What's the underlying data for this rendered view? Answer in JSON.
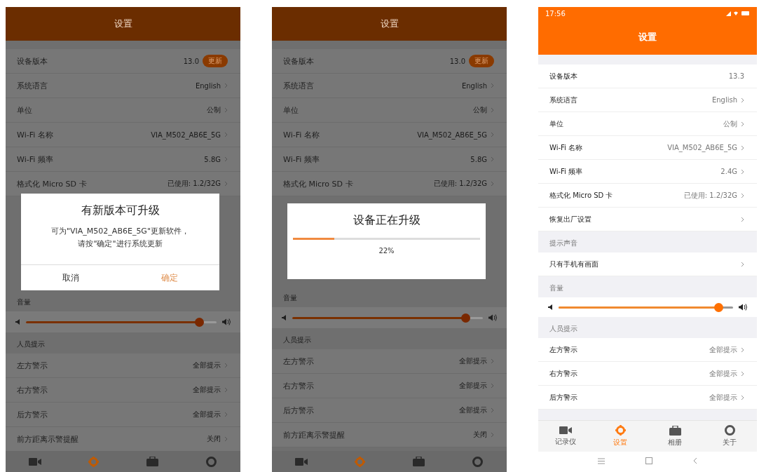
{
  "phones": [
    {
      "dimmed": true,
      "title": "设置",
      "blocks": [
        {
          "kind": "row",
          "label": "设备版本",
          "value": "13.0",
          "badge": "更新",
          "arrow": false
        },
        {
          "kind": "row",
          "label": "系统语言",
          "value": "English",
          "arrow": true
        },
        {
          "kind": "row",
          "label": "单位",
          "value": "公制",
          "arrow": true
        },
        {
          "kind": "row",
          "label": "Wi-Fi 名称",
          "value": "VIA_M502_AB6E_5G",
          "arrow": true
        },
        {
          "kind": "row",
          "label": "Wi-Fi 频率",
          "value": "5.8G",
          "arrow": true
        },
        {
          "kind": "row",
          "label": "格式化 Micro SD 卡",
          "value": "已使用: 1.2/32G",
          "arrow": true
        },
        {
          "kind": "confirm",
          "title": "有新版本可升级",
          "message_lines": [
            "可为\"VIA_M502_AB6E_5G\"更新软件，",
            "请按\"确定\"进行系统更新"
          ],
          "buttons": [
            {
              "label": "取消",
              "primary": false
            },
            {
              "label": "确定",
              "primary": true
            }
          ]
        },
        {
          "kind": "section",
          "label": "音量"
        },
        {
          "kind": "slider",
          "level": 0.93
        },
        {
          "kind": "section",
          "label": "人员提示"
        },
        {
          "kind": "row",
          "label": "左方警示",
          "value": "全部提示",
          "arrow": true
        },
        {
          "kind": "row",
          "label": "右方警示",
          "value": "全部提示",
          "arrow": true
        },
        {
          "kind": "row",
          "label": "后方警示",
          "value": "全部提示",
          "arrow": true
        },
        {
          "kind": "row",
          "label": "前方距离示警提醒",
          "value": "关闭",
          "arrow": true
        }
      ],
      "tabs": [
        {
          "kind": "recorder",
          "selected": false
        },
        {
          "kind": "settings",
          "selected": true
        },
        {
          "kind": "album",
          "selected": false
        },
        {
          "kind": "about",
          "selected": false
        }
      ]
    },
    {
      "dimmed": true,
      "title": "设置",
      "blocks": [
        {
          "kind": "row",
          "label": "设备版本",
          "value": "13.0",
          "badge": "更新",
          "arrow": false
        },
        {
          "kind": "row",
          "label": "系统语言",
          "value": "English",
          "arrow": true
        },
        {
          "kind": "row",
          "label": "单位",
          "value": "公制",
          "arrow": true
        },
        {
          "kind": "row",
          "label": "Wi-Fi 名称",
          "value": "VIA_M502_AB6E_5G",
          "arrow": true
        },
        {
          "kind": "row",
          "label": "Wi-Fi 频率",
          "value": "5.8G",
          "arrow": true
        },
        {
          "kind": "row",
          "label": "格式化 Micro SD 卡",
          "value": "已使用: 1.2/32G",
          "arrow": true
        },
        {
          "kind": "progress",
          "title": "设备正在升级",
          "level": 0.22,
          "reading": "22%"
        },
        {
          "kind": "section",
          "label": "音量"
        },
        {
          "kind": "slider",
          "level": 0.93
        },
        {
          "kind": "section",
          "label": "人员提示"
        },
        {
          "kind": "row",
          "label": "左方警示",
          "value": "全部提示",
          "arrow": true
        },
        {
          "kind": "row",
          "label": "右方警示",
          "value": "全部提示",
          "arrow": true
        },
        {
          "kind": "row",
          "label": "后方警示",
          "value": "全部提示",
          "arrow": true
        },
        {
          "kind": "row",
          "label": "前方距离示警提醒",
          "value": "关闭",
          "arrow": true
        }
      ],
      "tabs": [
        {
          "kind": "recorder",
          "selected": false
        },
        {
          "kind": "settings",
          "selected": true
        },
        {
          "kind": "album",
          "selected": false
        },
        {
          "kind": "about",
          "selected": false
        }
      ]
    },
    {
      "dimmed": false,
      "status_time": "17:56",
      "title": "设置",
      "blocks": [
        {
          "kind": "row",
          "label": "设备版本",
          "value": "13.3",
          "arrow": false
        },
        {
          "kind": "row",
          "label": "系统语言",
          "value": "English",
          "arrow": true
        },
        {
          "kind": "row",
          "label": "单位",
          "value": "公制",
          "arrow": true
        },
        {
          "kind": "row",
          "label": "Wi-Fi 名称",
          "value": "VIA_M502_AB6E_5G",
          "arrow": true
        },
        {
          "kind": "row",
          "label": "Wi-Fi 频率",
          "value": "2.4G",
          "arrow": true
        },
        {
          "kind": "row",
          "label": "格式化 Micro SD 卡",
          "value": "已使用: 1.2/32G",
          "arrow": true
        },
        {
          "kind": "row",
          "label": "恢复出厂设置",
          "arrow": true
        },
        {
          "kind": "section",
          "label": "提示声音"
        },
        {
          "kind": "row",
          "label": "只有手机有画面",
          "arrow": true
        },
        {
          "kind": "section",
          "label": "音量"
        },
        {
          "kind": "slider",
          "level": 0.94
        },
        {
          "kind": "section",
          "label": "人员提示"
        },
        {
          "kind": "row",
          "label": "左方警示",
          "value": "全部提示",
          "arrow": true
        },
        {
          "kind": "row",
          "label": "右方警示",
          "value": "全部提示",
          "arrow": true
        },
        {
          "kind": "row",
          "label": "后方警示",
          "value": "全部提示",
          "arrow": true
        }
      ],
      "tabs": [
        {
          "kind": "recorder",
          "label": "记录仪",
          "selected": false
        },
        {
          "kind": "settings",
          "label": "设置",
          "selected": true
        },
        {
          "kind": "album",
          "label": "相册",
          "selected": false
        },
        {
          "kind": "about",
          "label": "关于",
          "selected": false
        }
      ],
      "nav_bar": true
    }
  ]
}
